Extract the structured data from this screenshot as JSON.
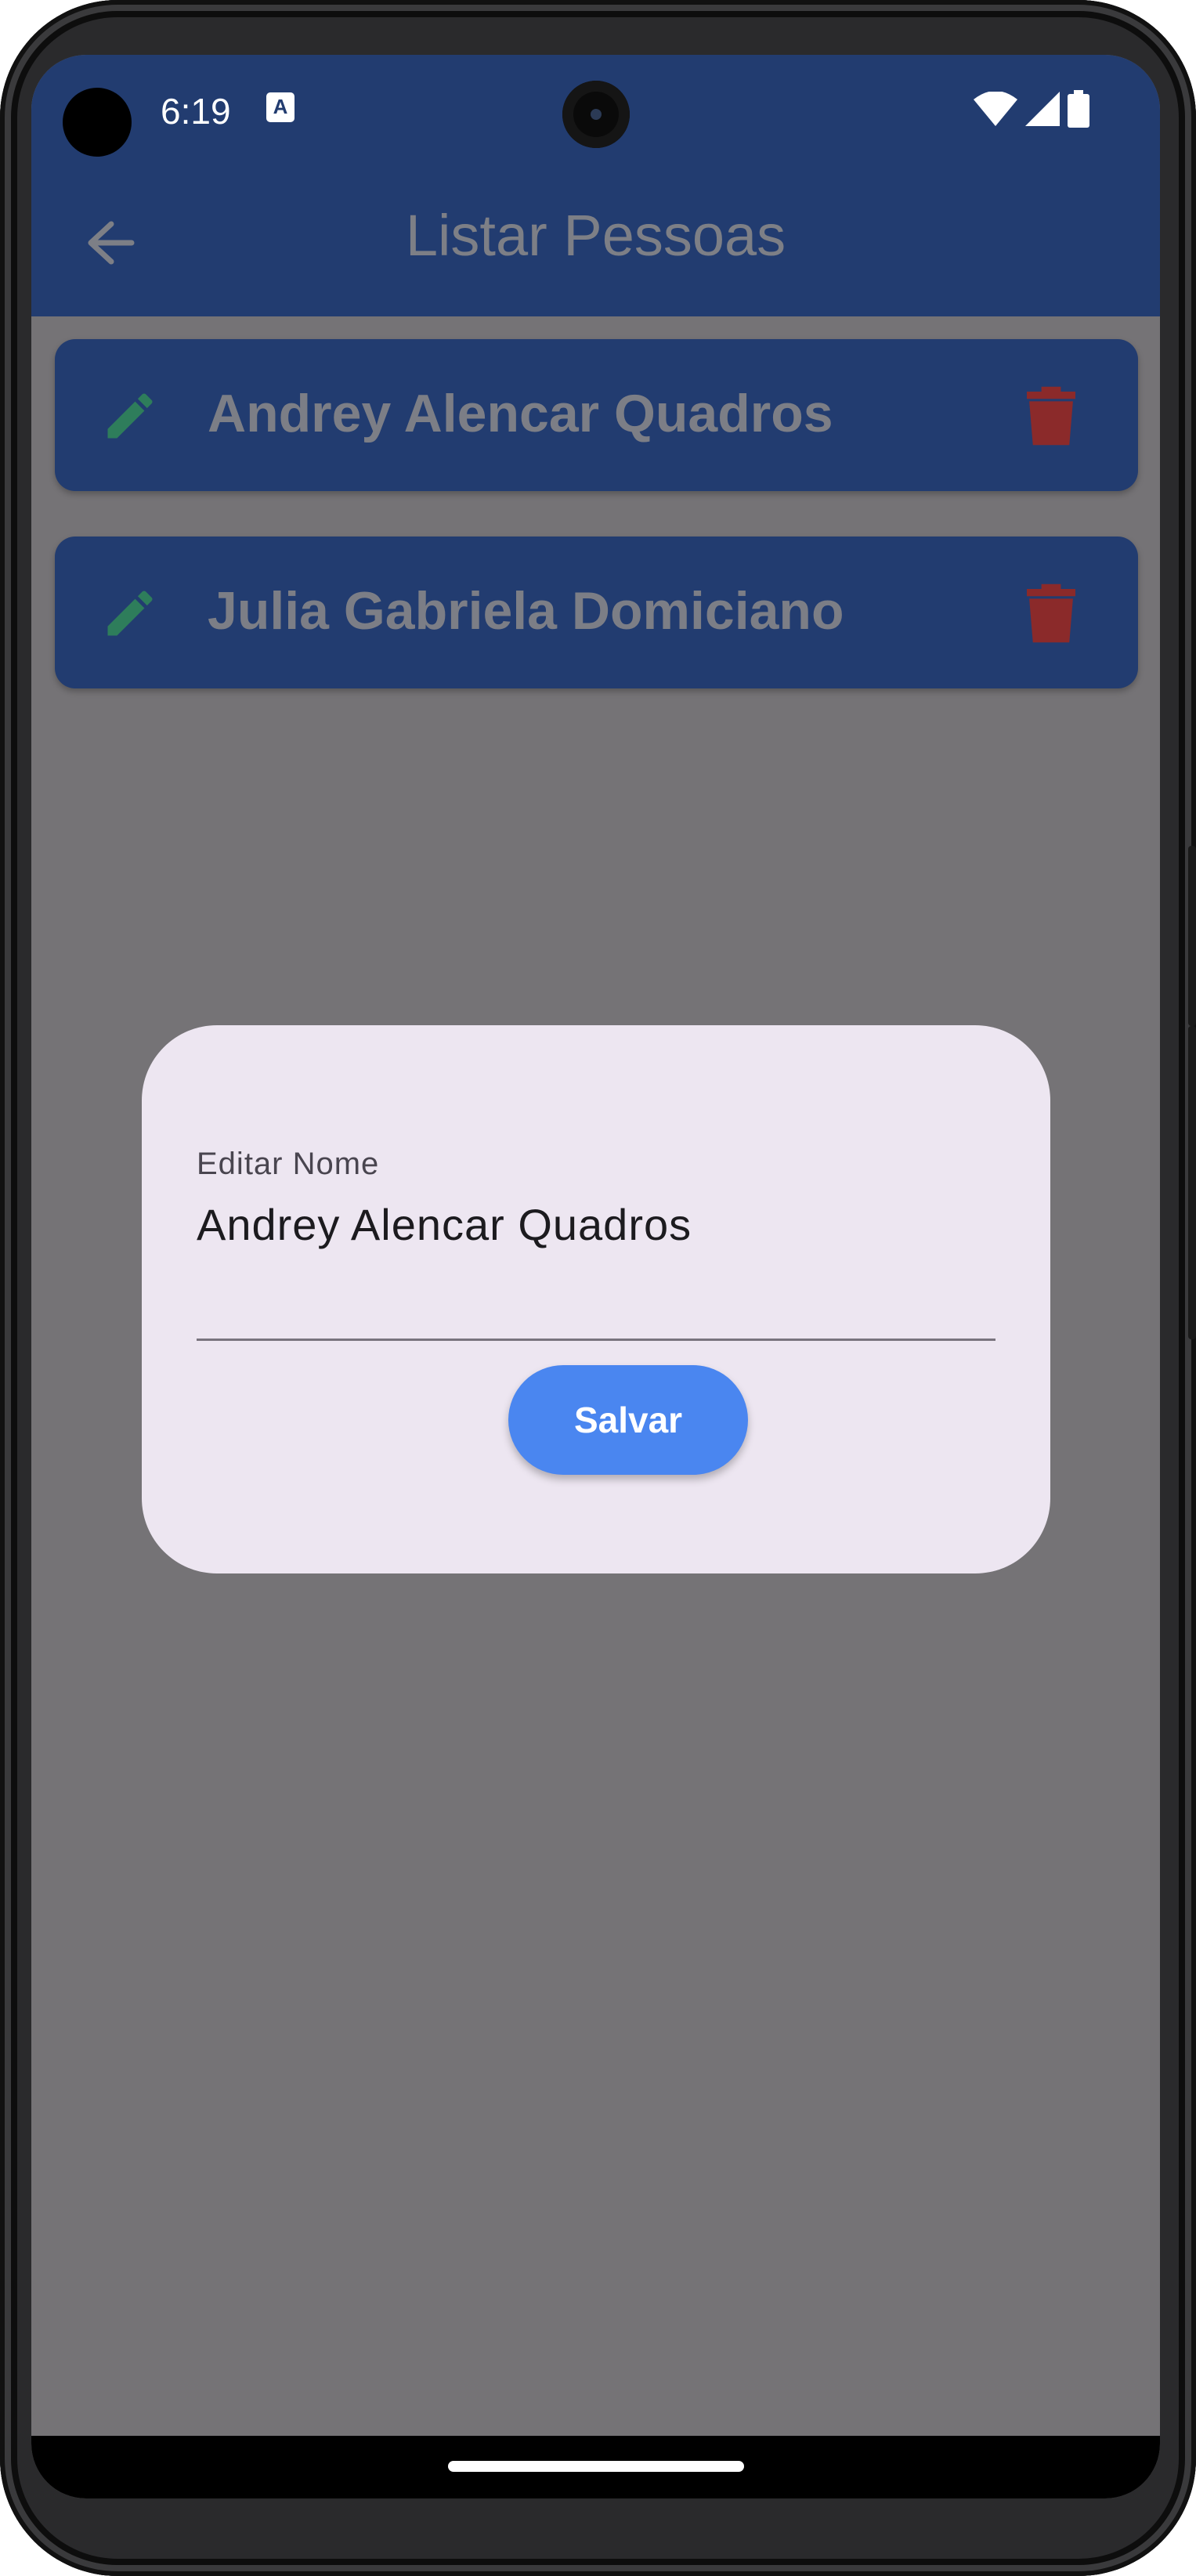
{
  "status_bar": {
    "time": "6:19",
    "notification_letter": "A",
    "icons": [
      "wifi-icon",
      "signal-icon",
      "battery-icon"
    ]
  },
  "app_bar": {
    "title": "Listar Pessoas",
    "back_icon": "arrow-left-icon",
    "background": "#223c70"
  },
  "list": {
    "items": [
      {
        "name": "Andrey Alencar Quadros",
        "edit_icon": "pencil-icon",
        "delete_icon": "trash-icon"
      },
      {
        "name": "Julia Gabriela Domiciano",
        "edit_icon": "pencil-icon",
        "delete_icon": "trash-icon"
      }
    ]
  },
  "dialog": {
    "field_label": "Editar Nome",
    "field_value": "Andrey Alencar Quadros",
    "save_label": "Salvar",
    "background": "#ede6f1",
    "button_color": "#4a86f0"
  },
  "colors": {
    "scrim": "#757376",
    "edit_icon": "#2e7d5b",
    "delete_icon": "#8b2a2a"
  }
}
